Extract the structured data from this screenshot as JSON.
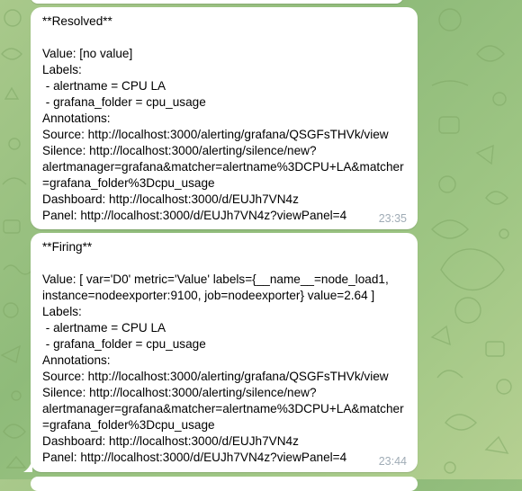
{
  "messages": [
    {
      "lines": [
        "**Resolved**",
        "",
        "Value: [no value]",
        "Labels:",
        " - alertname = CPU LA",
        " - grafana_folder = cpu_usage",
        "Annotations:",
        "Source: http://localhost:3000/alerting/grafana/QSGFsTHVk/view",
        "Silence: http://localhost:3000/alerting/silence/new?",
        "alertmanager=grafana&matcher=alertname%3DCPU+LA&matcher",
        "=grafana_folder%3Dcpu_usage",
        "Dashboard: http://localhost:3000/d/EUJh7VN4z",
        "Panel: http://localhost:3000/d/EUJh7VN4z?viewPanel=4"
      ],
      "time": "23:35"
    },
    {
      "lines": [
        "**Firing**",
        "",
        "Value: [ var='D0' metric='Value' labels={__name__=node_load1,",
        "instance=nodeexporter:9100, job=nodeexporter} value=2.64 ]",
        "Labels:",
        " - alertname = CPU LA",
        " - grafana_folder = cpu_usage",
        "Annotations:",
        "Source: http://localhost:3000/alerting/grafana/QSGFsTHVk/view",
        "Silence: http://localhost:3000/alerting/silence/new?",
        "alertmanager=grafana&matcher=alertname%3DCPU+LA&matcher",
        "=grafana_folder%3Dcpu_usage",
        "Dashboard: http://localhost:3000/d/EUJh7VN4z",
        "Panel: http://localhost:3000/d/EUJh7VN4z?viewPanel=4"
      ],
      "time": "23:44"
    }
  ]
}
